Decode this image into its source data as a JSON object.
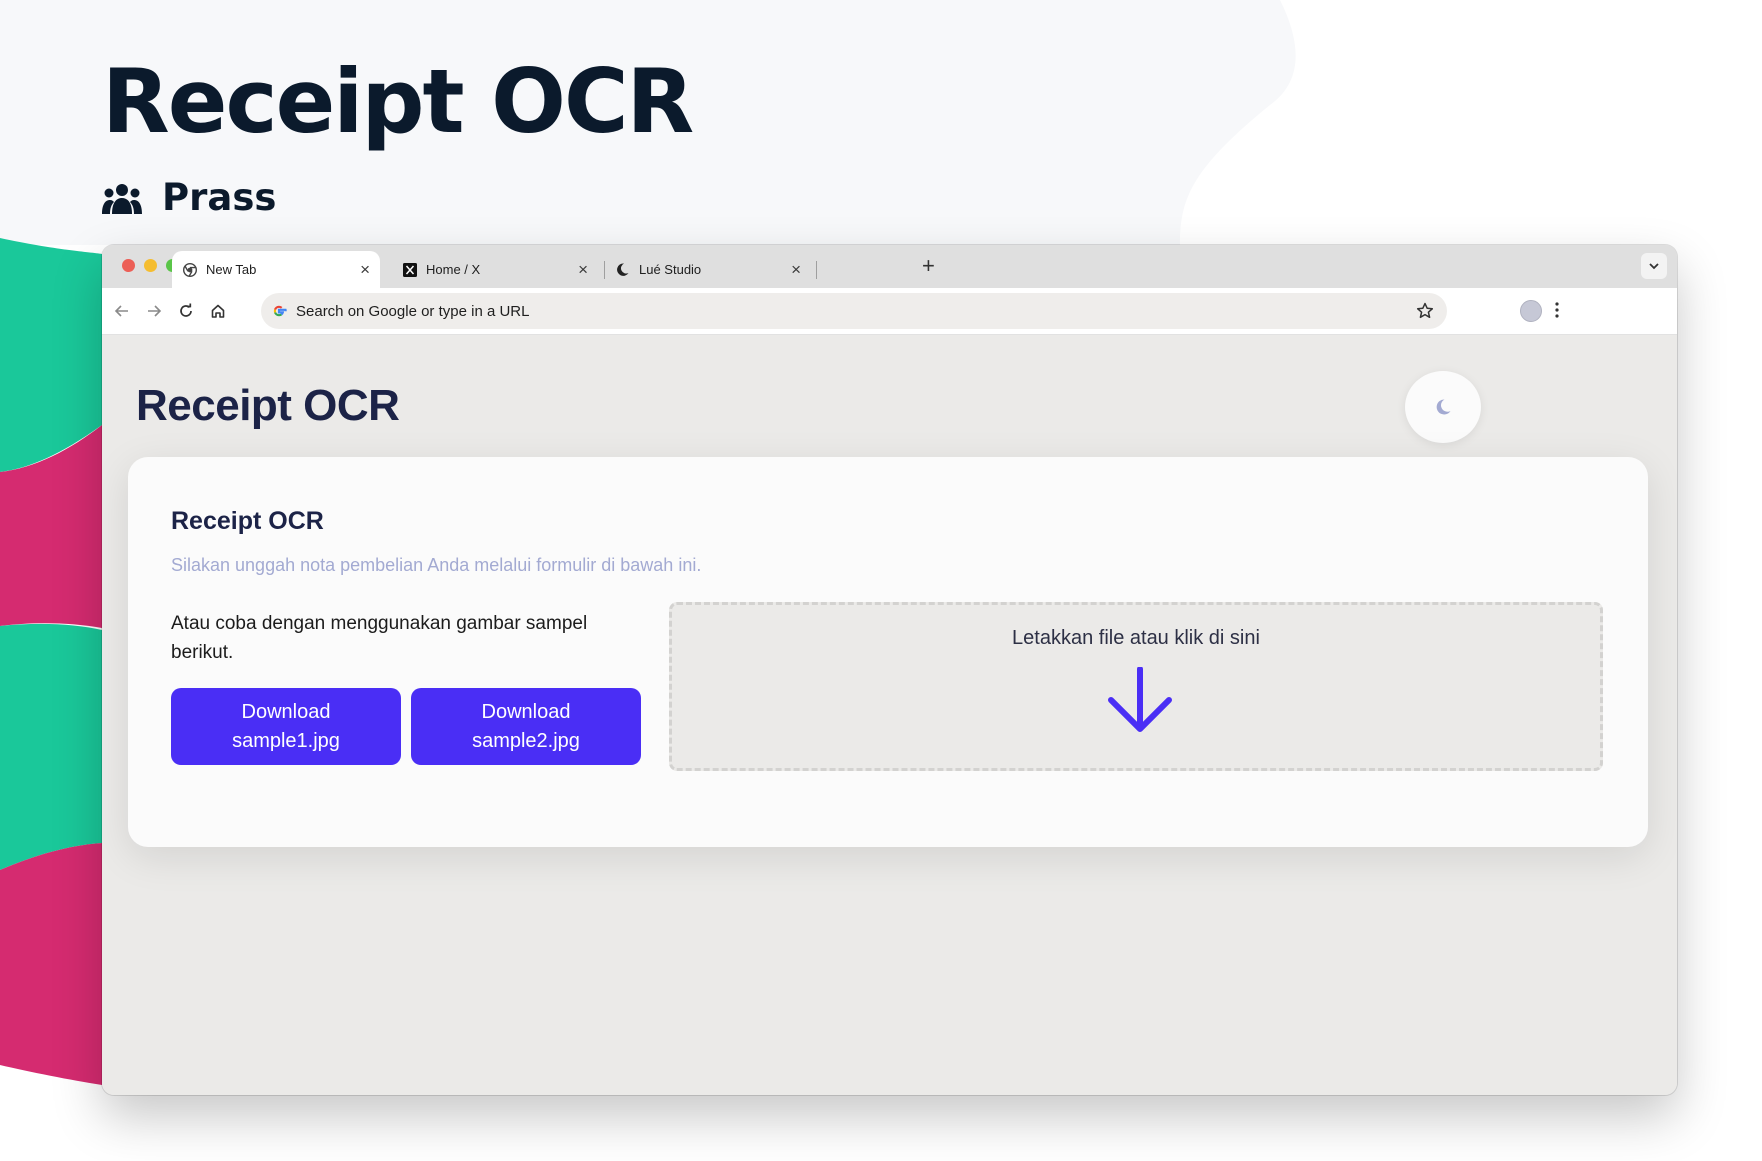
{
  "hero": {
    "title": "Receipt OCR",
    "author": "Prass",
    "author_icon": "users-group-icon"
  },
  "colors": {
    "teal": "#1ac89a",
    "magenta": "#d52b70",
    "accent": "#4a2ef5",
    "title_navy": "#1c2347",
    "subtitle_lavender": "#a3aad2"
  },
  "browser": {
    "tabs": [
      {
        "label": "New Tab",
        "icon": "chrome-icon",
        "active": true
      },
      {
        "label": "Home / X",
        "icon": "x-logo-icon",
        "active": false
      },
      {
        "label": "Lué Studio",
        "icon": "moon-icon",
        "active": false
      }
    ],
    "close_glyph": "×",
    "new_tab_glyph": "+",
    "address_placeholder": "Search on Google or type in a URL"
  },
  "app": {
    "page_title": "Receipt OCR",
    "theme_toggle_icon": "moon-icon",
    "card": {
      "title": "Receipt OCR",
      "subtitle": "Silakan unggah nota pembelian Anda melalui formulir di bawah ini.",
      "note": "Atau coba dengan menggunakan gambar sampel berikut.",
      "buttons": [
        {
          "label": "Download\nsample1.jpg"
        },
        {
          "label": "Download\nsample2.jpg"
        }
      ],
      "dropzone_label": "Letakkan file atau klik di sini",
      "dropzone_icon": "arrow-down-icon"
    }
  }
}
